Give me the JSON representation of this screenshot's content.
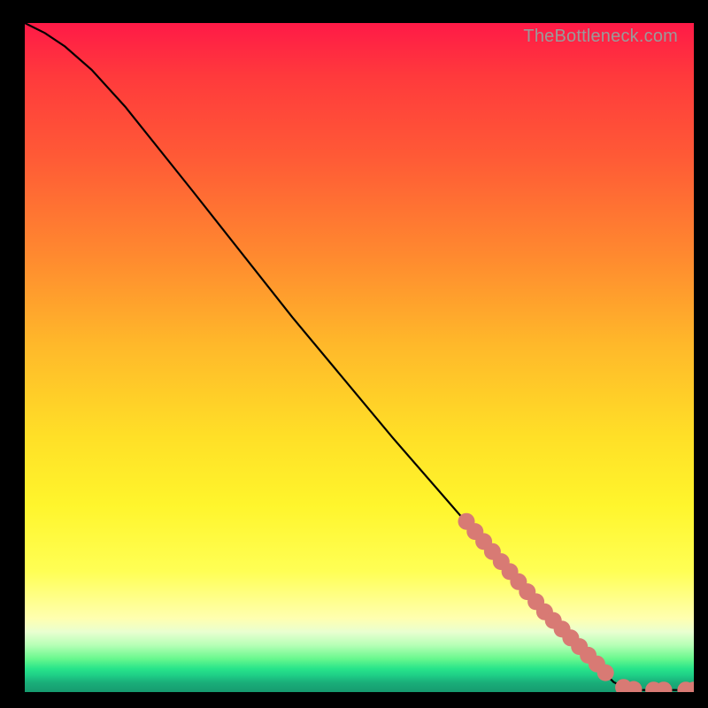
{
  "attribution": "TheBottleneck.com",
  "colors": {
    "dot": "#d87a74",
    "line": "#000000",
    "frame": "#000000"
  },
  "chart_data": {
    "type": "line",
    "title": "",
    "xlabel": "",
    "ylabel": "",
    "xlim": [
      0,
      100
    ],
    "ylim": [
      0,
      100
    ],
    "grid": false,
    "curve_points": [
      {
        "x": 0.0,
        "y": 100.0
      },
      {
        "x": 3.0,
        "y": 98.5
      },
      {
        "x": 6.0,
        "y": 96.5
      },
      {
        "x": 10.0,
        "y": 93.0
      },
      {
        "x": 15.0,
        "y": 87.5
      },
      {
        "x": 25.0,
        "y": 75.0
      },
      {
        "x": 40.0,
        "y": 56.0
      },
      {
        "x": 55.0,
        "y": 38.0
      },
      {
        "x": 65.0,
        "y": 26.5
      },
      {
        "x": 72.0,
        "y": 18.5
      },
      {
        "x": 78.0,
        "y": 12.0
      },
      {
        "x": 83.0,
        "y": 6.8
      },
      {
        "x": 86.0,
        "y": 3.5
      },
      {
        "x": 88.0,
        "y": 1.5
      },
      {
        "x": 90.0,
        "y": 0.5
      },
      {
        "x": 92.0,
        "y": 0.3
      },
      {
        "x": 95.0,
        "y": 0.3
      },
      {
        "x": 98.0,
        "y": 0.3
      },
      {
        "x": 100.0,
        "y": 0.3
      }
    ],
    "series": [
      {
        "name": "highlighted-segment",
        "style": "dots",
        "points": [
          {
            "x": 66.0,
            "y": 25.5
          },
          {
            "x": 67.3,
            "y": 24.0
          },
          {
            "x": 68.6,
            "y": 22.5
          },
          {
            "x": 69.9,
            "y": 21.0
          },
          {
            "x": 71.2,
            "y": 19.5
          },
          {
            "x": 72.5,
            "y": 18.0
          },
          {
            "x": 73.8,
            "y": 16.5
          },
          {
            "x": 75.1,
            "y": 15.0
          },
          {
            "x": 76.4,
            "y": 13.5
          },
          {
            "x": 77.7,
            "y": 12.0
          },
          {
            "x": 79.0,
            "y": 10.7
          },
          {
            "x": 80.3,
            "y": 9.4
          },
          {
            "x": 81.6,
            "y": 8.1
          },
          {
            "x": 82.9,
            "y": 6.8
          },
          {
            "x": 84.2,
            "y": 5.5
          },
          {
            "x": 85.5,
            "y": 4.2
          },
          {
            "x": 86.8,
            "y": 2.9
          },
          {
            "x": 89.5,
            "y": 0.7
          },
          {
            "x": 91.0,
            "y": 0.4
          },
          {
            "x": 94.0,
            "y": 0.3
          },
          {
            "x": 95.5,
            "y": 0.3
          },
          {
            "x": 98.8,
            "y": 0.3
          },
          {
            "x": 100.0,
            "y": 0.3
          }
        ]
      }
    ]
  }
}
